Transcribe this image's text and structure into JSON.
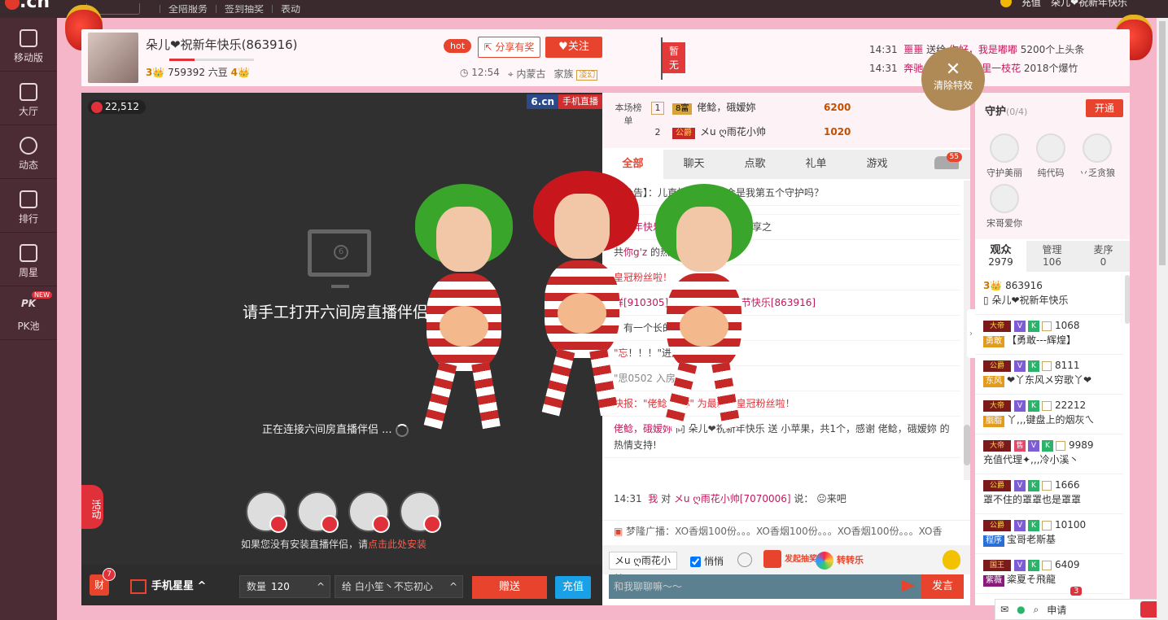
{
  "topbar": {
    "logo": ".cn",
    "settings": "设置",
    "nav": [
      "全陪服务",
      "签到抽奖",
      "表动"
    ],
    "recharge": "充值",
    "username": "朵儿❤祝新年快乐"
  },
  "sidebar": {
    "items": [
      {
        "label": "移动版",
        "icon": "mobile-icon"
      },
      {
        "label": "大厅",
        "icon": "tv-icon"
      },
      {
        "label": "动态",
        "icon": "compass-icon"
      },
      {
        "label": "排行",
        "icon": "crown-icon"
      },
      {
        "label": "周星",
        "icon": "basket-icon"
      },
      {
        "label": "PK池",
        "icon": "pk-icon",
        "badge": "NEW"
      }
    ]
  },
  "header": {
    "name": "朵儿❤祝新年快乐(863916)",
    "level_left": "3",
    "beans": "759392 六豆",
    "level_right": "4",
    "hot": "hot",
    "share": "分享有奖",
    "follow": "关注",
    "time": "12:54",
    "region": "内蒙古",
    "family_label": "家族",
    "family": "凌幻",
    "flag": "暂无",
    "notices": [
      {
        "time": "14:31",
        "user": "噩噩",
        "text": "送给",
        "to": "你好，我是嘟嘟",
        "gift": "5200个上头条"
      },
      {
        "time": "14:31",
        "user": "奔驰",
        "text": "",
        "to": "村里一枝花",
        "gift": "2018个爆竹"
      }
    ],
    "clear_fx": "清除特效"
  },
  "video": {
    "coins": "22,512",
    "brand_a": "6.cn",
    "brand_b": "手机直播",
    "title": "请手工打开六间房直播伴侣",
    "connecting": "正在连接六间房直播伴侣 ...",
    "install_prefix": "如果您没有安装直播伴侣，请",
    "install_link": "点击此处安装",
    "activity": "活动"
  },
  "bottombar": {
    "badge_count": "7",
    "box_label": "财",
    "gift": "手机星星",
    "qty_label": "数量",
    "qty": "120",
    "to_label": "给",
    "to": "白小笙丶不忘初心",
    "send": "赠送",
    "charge": "充值"
  },
  "rank": {
    "title": "本场榜单",
    "rows": [
      {
        "num": "1",
        "badge": "8富",
        "name": "佬鲶，硪嫒妳",
        "score": "6200"
      },
      {
        "num": "2",
        "badge": "公爵",
        "name": "メu ღ雨花小帅",
        "score": "1020"
      }
    ]
  },
  "chat_tabs": {
    "items": [
      "全部",
      "聊天",
      "点歌",
      "礼单",
      "游戏"
    ],
    "car_count": "55"
  },
  "chat": {
    "lines": [
      {
        "a": "间公告】：",
        "b": "儿直播间~~ 你会是我第五个守护吗？"
      },
      {
        "a": "",
        "b": ""
      },
      {
        "a": "",
        "nm": "祝新年快乐",
        "b": " 送 ⭐⭐⭐⭐⭐ 分享之"
      },
      {
        "a": "共",
        "nm": "你g'z",
        "b": " 的热情支持!"
      },
      {
        "red": "皇冠粉丝啦！"
      },
      {
        "a": "",
        "nm": "祥[910305] 对 朵儿❤祝情人节快乐[863916]",
        "b": ""
      },
      {
        "a": "：有一个",
        "b": "长的 🤔🤔🤔"
      },
      {
        "red": "\"忘",
        "b": "！！！\"进入房间"
      },
      {
        "small": "\"思",
        "b": "0502    入房间"
      },
      {
        "red": "快报：\"佬鲶    嫒妳\" 为最新的皇冠粉丝啦！"
      },
      {
        "nm": "佬鲶，硪嫒妳",
        "b": " 向 朵儿❤祝新年快乐 送 小苹果，共1个，感谢 佬鲶，硪嫒妳 的热情支持!"
      }
    ],
    "my_time": "14:31",
    "my_msg_me": "我",
    "my_msg_to": "对",
    "my_msg_user": "メu ღ雨花小帅[7070006]",
    "my_msg_says": "说：",
    "my_msg_text": "来吧",
    "broadcast": "梦隆广播：XO香烟100份。。。XO香烟100份。。。XO香烟100份。。。XO香"
  },
  "chatctrl": {
    "to": "メu ღ雨花小",
    "whisper": "悄悄",
    "lottery": "发起抽奖",
    "wheel": "转转乐",
    "placeholder": "和我聊聊嘛～～",
    "post": "发言"
  },
  "guard": {
    "title": "守护",
    "count": "(0/4)",
    "open": "开通",
    "items": [
      "守护美丽",
      "纯代码",
      "丷乏贪狼",
      "宋哥爱你"
    ]
  },
  "users": {
    "tabs": [
      {
        "label": "观众",
        "count": "2979"
      },
      {
        "label": "管理",
        "count": "106"
      },
      {
        "label": "麦序",
        "count": "0"
      }
    ],
    "list": [
      {
        "badge": "3",
        "id": "863916",
        "name": "朵儿❤祝新年快乐"
      },
      {
        "badge": "大帝",
        "id": "1068",
        "tag": "勇敢",
        "name": "【勇敢---辉煌】"
      },
      {
        "badge": "公爵",
        "id": "8111",
        "tag": "东风",
        "name": "❤丫东风メ穷歌丫❤"
      },
      {
        "badge": "大帝",
        "id": "22212",
        "tag": "胭脂",
        "name": "丫,,,键盘上的烟灰ㄟ"
      },
      {
        "badge": "大帝",
        "id": "9989",
        "name": "充值代理✦,,,冷小溪丶"
      },
      {
        "badge": "公爵",
        "id": "1666",
        "name": "罩不住的罩罩也是罩罩"
      },
      {
        "badge": "公爵",
        "id": "10100",
        "tag": "程序",
        "name": "宝哥老斯基"
      },
      {
        "badge": "国王",
        "id": "6409",
        "tag": "紫薇",
        "name": "粢夏そ飛龍"
      }
    ]
  },
  "statusbar": {
    "count": "3",
    "apply": "申请"
  }
}
